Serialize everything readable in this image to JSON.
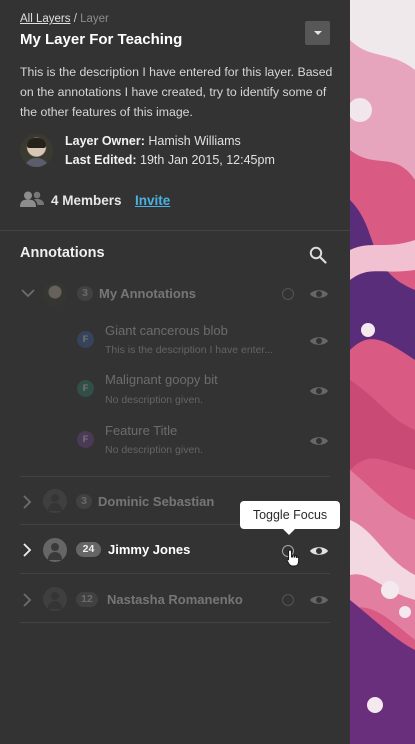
{
  "colors": {
    "panel_bg": "#333333",
    "accent_link": "#49b2e2",
    "annotation_blue": "#3a67b4",
    "annotation_green": "#2e8c73",
    "annotation_purple": "#7b4aa1",
    "tissue_pink": "#d95a83",
    "tissue_purple": "#5a2d7a"
  },
  "header": {
    "breadcrumb_root": "All Layers",
    "breadcrumb_sep": " / ",
    "breadcrumb_current": "Layer",
    "title": "My Layer For Teaching",
    "menu_icon": "chevron-down-icon",
    "description": "This is the description I have entered for this layer. Based on the  annotations I have created, try to identify some of the other features of this image."
  },
  "owner": {
    "owner_label": "Layer Owner:",
    "owner_name": "Hamish Williams",
    "edited_label": "Last Edited:",
    "edited_value": "19th Jan 2015, 12:45pm"
  },
  "members": {
    "icon": "users-icon",
    "label": "4 Members",
    "invite_label": "Invite"
  },
  "annotations": {
    "heading": "Annotations",
    "search_icon": "search-icon",
    "groups": [
      {
        "count": "3",
        "name": "My Annotations",
        "expanded": true,
        "items": [
          {
            "letter": "F",
            "title": "Giant cancerous blob",
            "desc": "This is the description I have enter..."
          },
          {
            "letter": "F",
            "title": "Malignant goopy bit",
            "desc": "No description given."
          },
          {
            "letter": "F",
            "title": "Feature Title",
            "desc": "No description given."
          }
        ]
      },
      {
        "count": "3",
        "name": "Dominic Sebastian",
        "expanded": false
      },
      {
        "count": "24",
        "name": "Jimmy Jones",
        "expanded": false
      },
      {
        "count": "12",
        "name": "Nastasha Romanenko",
        "expanded": false
      }
    ]
  },
  "tooltip": {
    "text": "Toggle Focus"
  }
}
